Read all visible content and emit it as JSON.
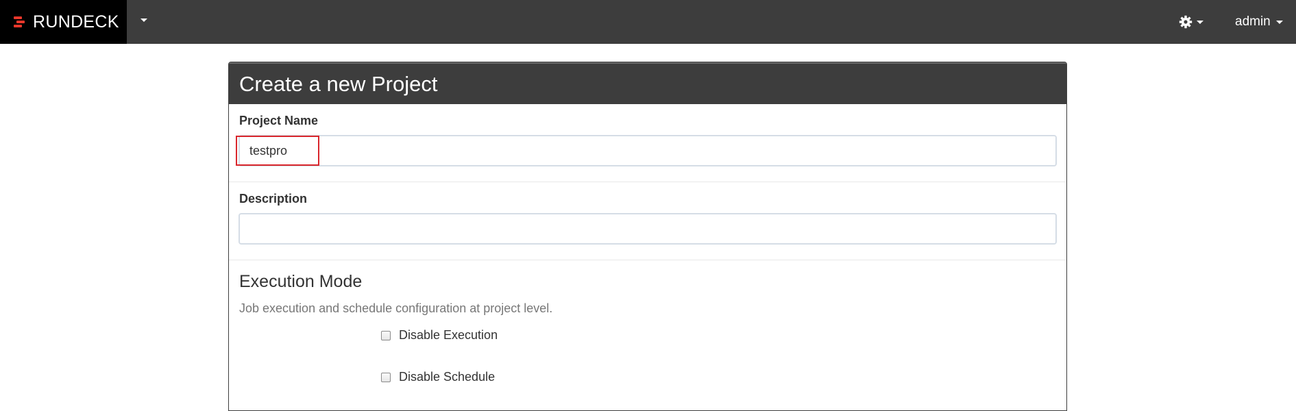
{
  "navbar": {
    "brand": "RUNDECK",
    "user": "admin"
  },
  "panel": {
    "title": "Create a new Project"
  },
  "form": {
    "project_name_label": "Project Name",
    "project_name_value": "testpro",
    "description_label": "Description",
    "description_value": ""
  },
  "execution": {
    "title": "Execution Mode",
    "help": "Job execution and schedule configuration at project level.",
    "checkboxes": [
      {
        "label": "Disable Execution",
        "checked": false
      },
      {
        "label": "Disable Schedule",
        "checked": false
      }
    ]
  },
  "colors": {
    "navbar": "#3d3d3d",
    "brand_bg": "#000000",
    "brand_accent": "#e7372b",
    "highlight": "#d9262c"
  }
}
